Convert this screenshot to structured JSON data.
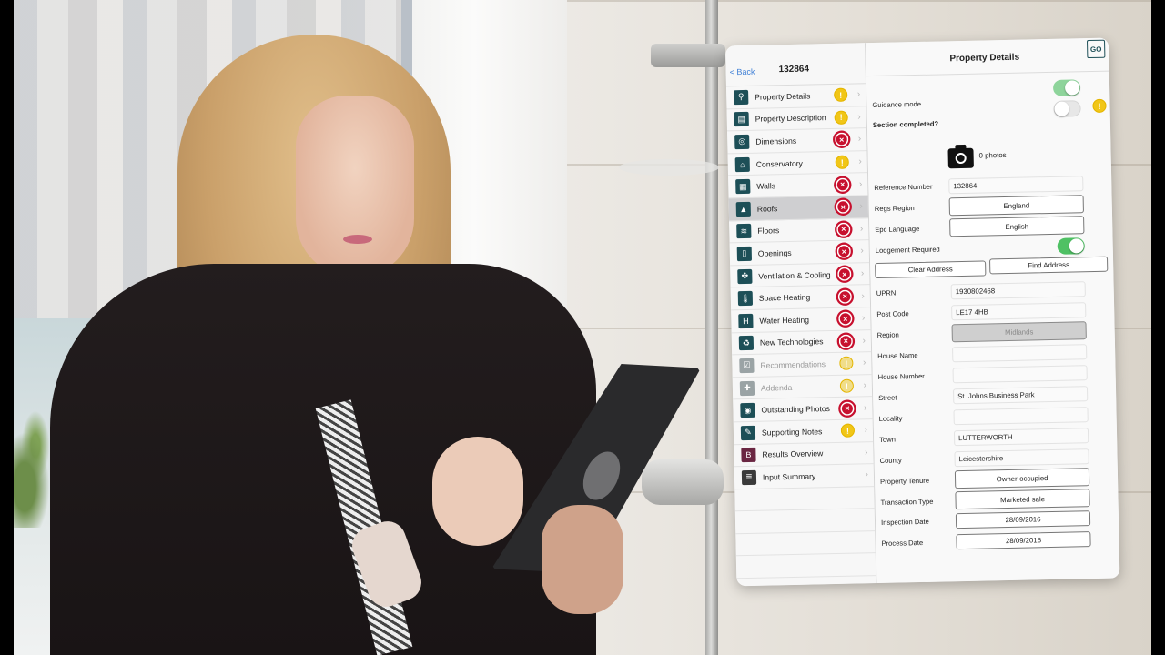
{
  "master": {
    "back_label": "< Back",
    "title": "132864",
    "items": [
      {
        "label": "Property Details",
        "icon": "location-pin-icon",
        "glyph": "⚲",
        "status": "warning",
        "muted": false,
        "selected": false
      },
      {
        "label": "Property Description",
        "icon": "book-icon",
        "glyph": "▤",
        "status": "warning",
        "muted": false,
        "selected": false
      },
      {
        "label": "Dimensions",
        "icon": "tape-measure-icon",
        "glyph": "◎",
        "status": "error",
        "muted": false,
        "selected": false
      },
      {
        "label": "Conservatory",
        "icon": "conservatory-icon",
        "glyph": "⌂",
        "status": "warning",
        "muted": false,
        "selected": false
      },
      {
        "label": "Walls",
        "icon": "bricks-icon",
        "glyph": "▦",
        "status": "error",
        "muted": false,
        "selected": false
      },
      {
        "label": "Roofs",
        "icon": "roof-icon",
        "glyph": "▲",
        "status": "error",
        "muted": false,
        "selected": true
      },
      {
        "label": "Floors",
        "icon": "layers-icon",
        "glyph": "≋",
        "status": "error",
        "muted": false,
        "selected": false
      },
      {
        "label": "Openings",
        "icon": "door-icon",
        "glyph": "▯",
        "status": "error",
        "muted": false,
        "selected": false
      },
      {
        "label": "Ventilation & Cooling",
        "icon": "fan-icon",
        "glyph": "✤",
        "status": "error",
        "muted": false,
        "selected": false
      },
      {
        "label": "Space Heating",
        "icon": "thermometer-icon",
        "glyph": "🌡",
        "status": "error",
        "muted": false,
        "selected": false
      },
      {
        "label": "Water Heating",
        "icon": "water-heater-icon",
        "glyph": "H",
        "status": "error",
        "muted": false,
        "selected": false
      },
      {
        "label": "New Technologies",
        "icon": "recycle-icon",
        "glyph": "♻",
        "status": "error",
        "muted": false,
        "selected": false
      },
      {
        "label": "Recommendations",
        "icon": "checklist-icon",
        "glyph": "☑",
        "status": "warning",
        "muted": true,
        "selected": false
      },
      {
        "label": "Addenda",
        "icon": "document-plus-icon",
        "glyph": "✚",
        "status": "warning",
        "muted": true,
        "selected": false
      },
      {
        "label": "Outstanding Photos",
        "icon": "camera-icon",
        "glyph": "◉",
        "status": "error",
        "muted": false,
        "selected": false
      },
      {
        "label": "Supporting Notes",
        "icon": "edit-note-icon",
        "glyph": "✎",
        "status": "warning",
        "muted": false,
        "selected": false
      },
      {
        "label": "Results Overview",
        "icon": "results-icon",
        "glyph": "B",
        "status": "none",
        "muted": false,
        "selected": false,
        "color": "maroon"
      },
      {
        "label": "Input Summary",
        "icon": "summary-document-icon",
        "glyph": "≣",
        "status": "none",
        "muted": false,
        "selected": false,
        "color": "dark"
      }
    ]
  },
  "detail": {
    "title": "Property Details",
    "logo_text": "GO",
    "guidance_mode": {
      "label": "Guidance mode",
      "on": true
    },
    "section_completed": {
      "label": "Section completed?",
      "on": false,
      "status": "warning"
    },
    "photos": {
      "count_label": "0 photos"
    },
    "fields": {
      "reference_number": {
        "label": "Reference Number",
        "value": "132864"
      },
      "regs_region": {
        "label": "Regs Region",
        "value": "England"
      },
      "epc_language": {
        "label": "Epc Language",
        "value": "English"
      },
      "lodgement_required": {
        "label": "Lodgement Required",
        "on": true
      },
      "uprn": {
        "label": "UPRN",
        "value": "1930802468"
      },
      "post_code": {
        "label": "Post Code",
        "value": "LE17 4HB"
      },
      "region": {
        "label": "Region",
        "value": "Midlands"
      },
      "house_name": {
        "label": "House Name",
        "value": ""
      },
      "house_number": {
        "label": "House Number",
        "value": ""
      },
      "street": {
        "label": "Street",
        "value": "St. Johns Business Park"
      },
      "locality": {
        "label": "Locality",
        "value": ""
      },
      "town": {
        "label": "Town",
        "value": "LUTTERWORTH"
      },
      "county": {
        "label": "County",
        "value": "Leicestershire"
      },
      "property_tenure": {
        "label": "Property Tenure",
        "value": "Owner-occupied"
      },
      "transaction_type": {
        "label": "Transaction Type",
        "value": "Marketed sale"
      },
      "inspection_date": {
        "label": "Inspection Date",
        "value": "28/09/2016"
      },
      "process_date": {
        "label": "Process Date",
        "value": "28/09/2016"
      }
    },
    "buttons": {
      "clear_address": "Clear Address",
      "find_address": "Find Address"
    }
  },
  "status_glyphs": {
    "warning": "!",
    "error": "×",
    "chevron": "›"
  },
  "colors": {
    "accent_teal": "#1d4f57",
    "warning": "#f1c617",
    "error": "#c7102e",
    "toggle_on": "#4fc164",
    "link_blue": "#3e7fd6"
  }
}
